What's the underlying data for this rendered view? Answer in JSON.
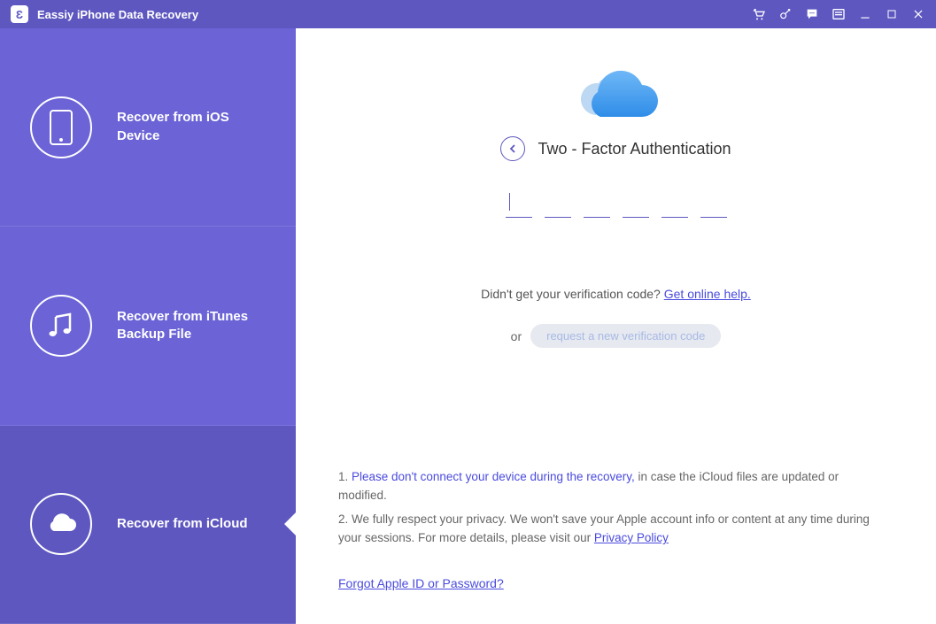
{
  "titlebar": {
    "logo_glyph": "Ɛ",
    "app_title": "Eassiy iPhone Data Recovery"
  },
  "sidebar": {
    "items": [
      {
        "label": "Recover from iOS Device"
      },
      {
        "label": "Recover from iTunes Backup File"
      },
      {
        "label": "Recover from iCloud"
      }
    ]
  },
  "main": {
    "heading": "Two - Factor Authentication",
    "helper_prefix": "Didn't get your verification code? ",
    "helper_link": "Get online help.",
    "or_text": "or",
    "request_btn": "request a new verification code",
    "note1_num": "1. ",
    "note1_blue": "Please don't connect your device during the recovery,",
    "note1_rest": " in case the iCloud files are updated or modified.",
    "note2_prefix": "2. We fully respect your privacy. We won't save your Apple account info or content at any time during your sessions. For more details, please visit our ",
    "privacy_link": "Privacy Policy",
    "forgot_link": "Forgot Apple ID or Password?"
  }
}
